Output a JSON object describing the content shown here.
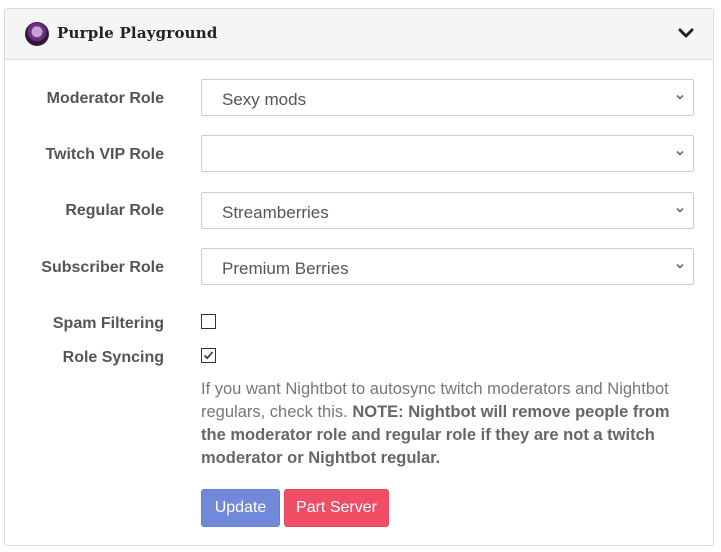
{
  "server": {
    "name": "Purple Playground"
  },
  "fields": [
    {
      "label": "Moderator Role",
      "value": "Sexy mods"
    },
    {
      "label": "Twitch VIP Role",
      "value": ""
    },
    {
      "label": "Regular Role",
      "value": "Streamberries"
    },
    {
      "label": "Subscriber Role",
      "value": "Premium Berries"
    }
  ],
  "toggles": [
    {
      "label": "Spam Filtering",
      "checked": false
    },
    {
      "label": "Role Syncing",
      "checked": true
    }
  ],
  "help": {
    "text": "If you want Nightbot to autosync twitch moderators and Nightbot regulars, check this. ",
    "note": "NOTE: Nightbot will remove people from the moderator role and regular role if they are not a twitch moderator or Nightbot regular."
  },
  "buttons": {
    "update": "Update",
    "part": "Part Server"
  },
  "colors": {
    "update": "#7289da",
    "part": "#f04d67",
    "header_bg": "#f5f5f5"
  }
}
